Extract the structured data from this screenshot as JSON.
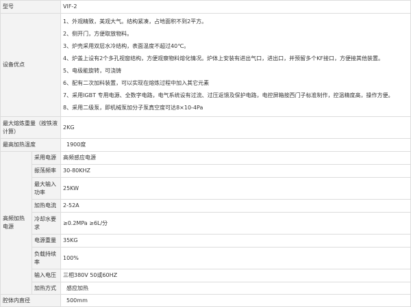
{
  "table": {
    "rows": [
      {
        "label": "型号",
        "value": "VIF-2"
      },
      {
        "label": "设备优点",
        "features": [
          "1、外观精致，美观大气。结构紧凑，占地面积不到2平方。",
          "2、侧开门，方便取放物料。",
          "3、炉壳采用双层水冷结构，表面温度不超过40℃。",
          "4、炉盖上设有2个多孔视窗结构，方便观察物料熔化情况。炉体上安装有进出气口，进出口，并预留多个KF接口，方便接其他装置。",
          "5、电极能旋转，可浇铸",
          "6、配有二次加料装置，可以实现在熔炼过程中加入其它元素",
          "7、采用IGBT 专用电源、全数字电路，电气系统设有过流、过压返馈及保护电路，电控屏箱按西门子标准制作，控温精度高，操作方便。",
          "8、采用二级泵，即机械泵加分子泵真空度可达8×10-4Pa"
        ]
      },
      {
        "label": "最大熔炼重量（按铁液计算）",
        "value": "2KG"
      },
      {
        "label": "最高加热温度",
        "value": "1900度"
      },
      {
        "label": "高频加热电源",
        "sub": [
          {
            "label": "采用电源",
            "value": "高频感应电源"
          },
          {
            "label": "振荡频率",
            "value": "30-80KHZ"
          },
          {
            "label": "最大输入功率",
            "value": "25KW"
          },
          {
            "label": "加热电流",
            "value": "2-52A"
          },
          {
            "label": "冷却水要求",
            "value": "≥0.2MPa ≥6L/分"
          },
          {
            "label": "电源重量",
            "value": "35KG"
          },
          {
            "label": "负载持续率",
            "value": "100%"
          },
          {
            "label": "输入电压",
            "value": "三相380V   50或60HZ"
          },
          {
            "label": "加热方式",
            "value": "感应加热"
          }
        ]
      },
      {
        "label": "腔体内直径",
        "value": "500mm"
      }
    ]
  }
}
